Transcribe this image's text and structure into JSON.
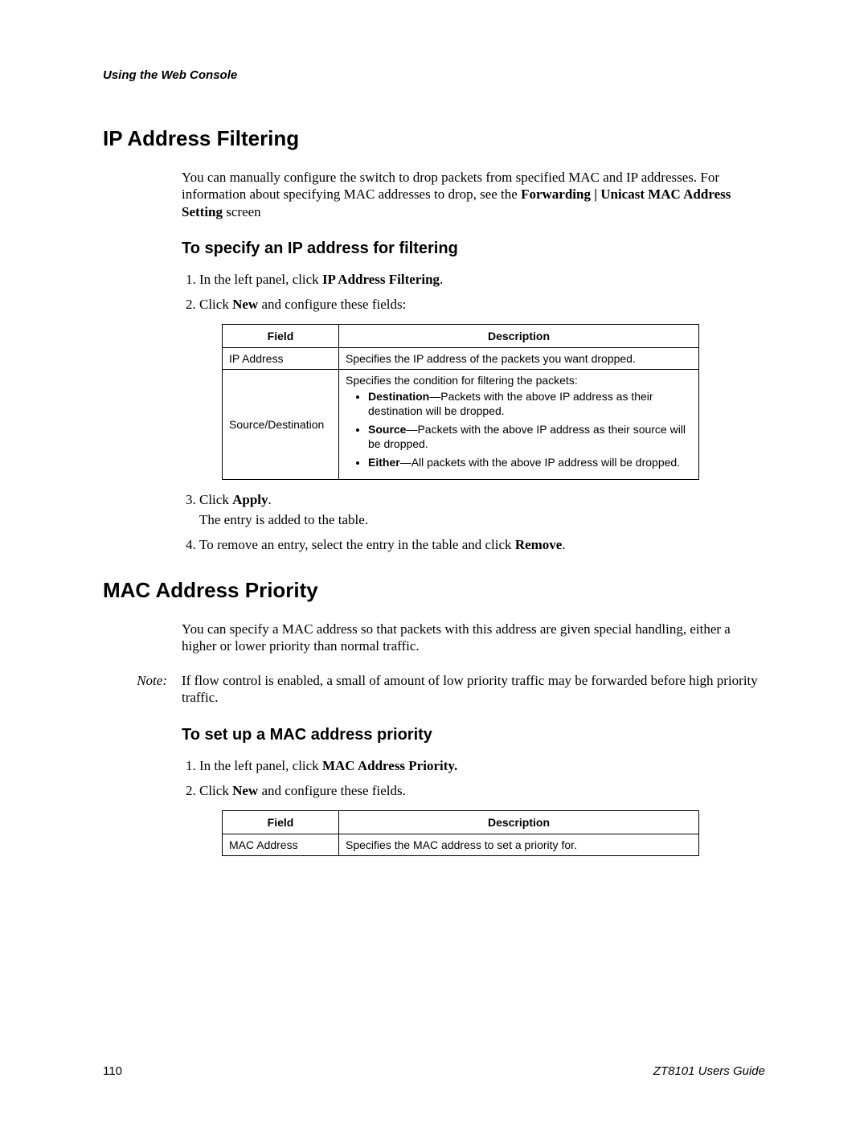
{
  "running_head": "Using the Web Console",
  "section1": {
    "title": "IP Address Filtering",
    "intro_html": "You can manually configure the switch to drop packets from specified MAC and IP addresses. For information about specifying MAC addresses to drop, see the <b class='serif'>Forwarding | Unicast MAC Address Setting</b> screen",
    "subhead": "To specify an IP address for filtering",
    "step1_html": "In the left panel, click <b class='serif'>IP Address Filtering</b>.",
    "step2_html": "Click <b class='serif'>New</b> and configure these fields:",
    "table": {
      "col1": "Field",
      "col2": "Description",
      "rows": [
        {
          "field": "IP Address",
          "desc_html": "Specifies the IP address of the packets you want dropped."
        },
        {
          "field": "Source/Destination",
          "desc_html": "Specifies the condition for filtering the packets:<ul><li><b>Destination</b>—Packets with the above IP address as their destination will be dropped.</li><li><b>Source</b>—Packets with the above IP address as their source will be dropped.</li><li><b>Either</b>—All packets with the above IP address will be dropped.</li></ul>"
        }
      ]
    },
    "step3_html": "Click <b class='serif'>Apply</b>.",
    "step3_sub": "The entry is added to the table.",
    "step4_html": "To remove an entry, select the entry in the table and click <b class='serif'>Remove</b>."
  },
  "section2": {
    "title": "MAC Address Priority",
    "intro": "You can specify a MAC address so that packets with this address are given special handling, either a higher or lower priority than normal traffic.",
    "note_label": "Note:",
    "note_text": "If flow control is enabled, a small of amount of low priority traffic may be forwarded before high priority traffic.",
    "subhead": "To set up a MAC address priority",
    "step1_html": "In the left panel, click <b class='serif'>MAC Address Priority.</b>",
    "step2_html": "Click <b class='serif'>New</b> and configure these fields.",
    "table": {
      "col1": "Field",
      "col2": "Description",
      "rows": [
        {
          "field": "MAC Address",
          "desc_html": "Specifies the MAC address to set a priority for."
        }
      ]
    }
  },
  "footer": {
    "page": "110",
    "guide": "ZT8101 Users Guide"
  }
}
